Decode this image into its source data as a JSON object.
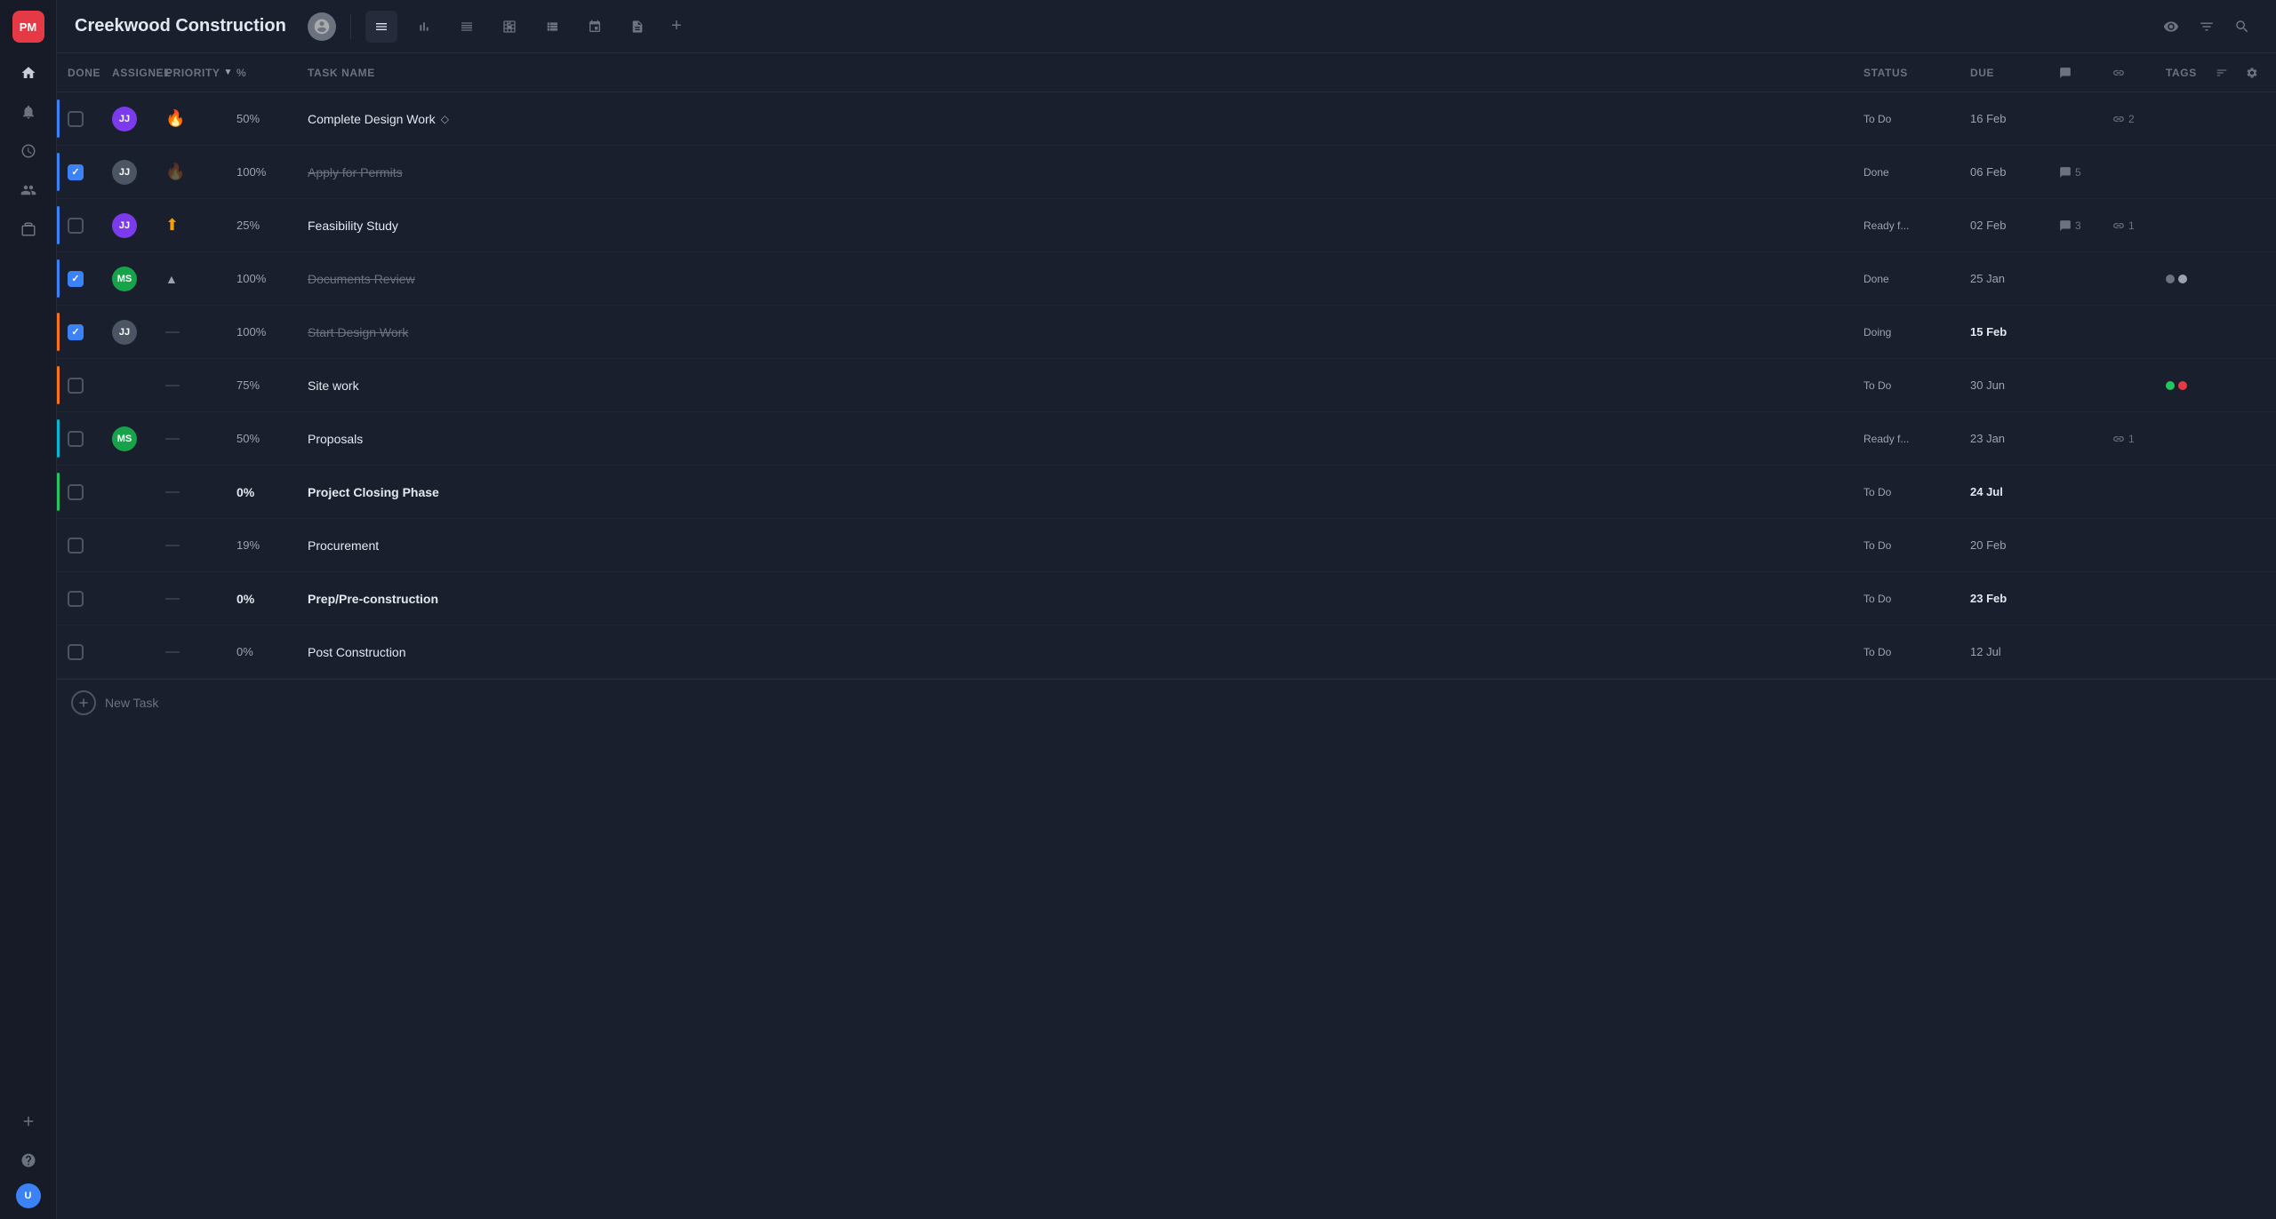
{
  "app": {
    "logo": "PM",
    "project_title": "Creekwood Construction"
  },
  "sidebar": {
    "icons": [
      {
        "name": "home-icon",
        "glyph": "⌂",
        "active": false
      },
      {
        "name": "notifications-icon",
        "glyph": "🔔",
        "active": false
      },
      {
        "name": "clock-icon",
        "glyph": "⏱",
        "active": false
      },
      {
        "name": "users-icon",
        "glyph": "👥",
        "active": false
      },
      {
        "name": "briefcase-icon",
        "glyph": "💼",
        "active": false
      }
    ],
    "bottom_icons": [
      {
        "name": "add-icon",
        "glyph": "+",
        "active": false
      },
      {
        "name": "help-icon",
        "glyph": "?",
        "active": false
      }
    ]
  },
  "topbar": {
    "view_icons": [
      {
        "name": "list-view-icon",
        "glyph": "☰",
        "active": true
      },
      {
        "name": "chart-view-icon",
        "glyph": "⦿",
        "active": false
      },
      {
        "name": "menu-view-icon",
        "glyph": "≡",
        "active": false
      },
      {
        "name": "table-view-icon",
        "glyph": "⊞",
        "active": false
      },
      {
        "name": "pulse-view-icon",
        "glyph": "∿",
        "active": false
      },
      {
        "name": "calendar-view-icon",
        "glyph": "📅",
        "active": false
      },
      {
        "name": "doc-view-icon",
        "glyph": "📄",
        "active": false
      }
    ],
    "right_icons": [
      {
        "name": "eye-icon",
        "glyph": "👁"
      },
      {
        "name": "filter-icon",
        "glyph": "⚗"
      },
      {
        "name": "search-icon",
        "glyph": "🔍"
      }
    ]
  },
  "table": {
    "columns": [
      {
        "id": "done",
        "label": "DONE"
      },
      {
        "id": "assignee",
        "label": "ASSIGNEE"
      },
      {
        "id": "priority",
        "label": "PRIORITY"
      },
      {
        "id": "percent",
        "label": "%"
      },
      {
        "id": "task_name",
        "label": "TASK NAME"
      },
      {
        "id": "status",
        "label": "STATUS"
      },
      {
        "id": "due",
        "label": "DUE"
      },
      {
        "id": "comments",
        "label": ""
      },
      {
        "id": "links",
        "label": ""
      },
      {
        "id": "tags",
        "label": "TAGS"
      }
    ],
    "rows": [
      {
        "id": "row1",
        "done": false,
        "assignee_initials": "JJ",
        "assignee_color": "av-purple",
        "priority_type": "fire",
        "priority_glyph": "🔥",
        "percent": "50%",
        "percent_style": "normal",
        "task_name": "Complete Design Work",
        "task_style": "normal",
        "has_diamond": true,
        "status": "To Do",
        "status_style": "normal",
        "due": "16 Feb",
        "due_style": "normal",
        "comments": 0,
        "links": 2,
        "tags": [],
        "bar_color": "bar-blue"
      },
      {
        "id": "row2",
        "done": true,
        "assignee_initials": "JJ",
        "assignee_color": "av-gray",
        "priority_type": "fire-gray",
        "priority_glyph": "🔥",
        "percent": "100%",
        "percent_style": "normal",
        "task_name": "Apply for Permits",
        "task_style": "strikethrough",
        "has_diamond": false,
        "status": "Done",
        "status_style": "normal",
        "due": "06 Feb",
        "due_style": "normal",
        "comments": 5,
        "links": 0,
        "tags": [],
        "bar_color": "bar-blue"
      },
      {
        "id": "row3",
        "done": false,
        "assignee_initials": "JJ",
        "assignee_color": "av-purple",
        "priority_type": "arrow-up",
        "priority_glyph": "⬆",
        "percent": "25%",
        "percent_style": "normal",
        "task_name": "Feasibility Study",
        "task_style": "normal",
        "has_diamond": false,
        "status": "Ready f...",
        "status_style": "normal",
        "due": "02 Feb",
        "due_style": "normal",
        "comments": 3,
        "links": 1,
        "tags": [],
        "bar_color": "bar-blue"
      },
      {
        "id": "row4",
        "done": true,
        "assignee_initials": "MS",
        "assignee_color": "av-green",
        "priority_type": "triangle",
        "priority_glyph": "▲",
        "percent": "100%",
        "percent_style": "normal",
        "task_name": "Documents Review",
        "task_style": "strikethrough",
        "has_diamond": false,
        "status": "Done",
        "status_style": "normal",
        "due": "25 Jan",
        "due_style": "normal",
        "comments": 0,
        "links": 0,
        "tags": [
          {
            "color": "#6b7280"
          },
          {
            "color": "#9ca3af"
          }
        ],
        "bar_color": "bar-blue"
      },
      {
        "id": "row5",
        "done": true,
        "assignee_initials": "JJ",
        "assignee_color": "av-gray",
        "priority_type": "dash",
        "priority_glyph": "—",
        "percent": "100%",
        "percent_style": "normal",
        "task_name": "Start Design Work",
        "task_style": "strikethrough",
        "has_diamond": false,
        "status": "Doing",
        "status_style": "normal",
        "due": "15 Feb",
        "due_style": "bold",
        "comments": 0,
        "links": 0,
        "tags": [],
        "bar_color": "bar-orange"
      },
      {
        "id": "row6",
        "done": false,
        "assignee_initials": "",
        "assignee_color": "",
        "priority_type": "dash",
        "priority_glyph": "—",
        "percent": "75%",
        "percent_style": "normal",
        "task_name": "Site work",
        "task_style": "normal",
        "has_diamond": false,
        "status": "To Do",
        "status_style": "normal",
        "due": "30 Jun",
        "due_style": "normal",
        "comments": 0,
        "links": 0,
        "tags": [
          {
            "color": "#22c55e"
          },
          {
            "color": "#e63946"
          }
        ],
        "bar_color": "bar-orange"
      },
      {
        "id": "row7",
        "done": false,
        "assignee_initials": "MS",
        "assignee_color": "av-green",
        "priority_type": "dash",
        "priority_glyph": "—",
        "percent": "50%",
        "percent_style": "normal",
        "task_name": "Proposals",
        "task_style": "normal",
        "has_diamond": false,
        "status": "Ready f...",
        "status_style": "normal",
        "due": "23 Jan",
        "due_style": "normal",
        "comments": 0,
        "links": 1,
        "tags": [],
        "bar_color": "bar-cyan"
      },
      {
        "id": "row8",
        "done": false,
        "assignee_initials": "",
        "assignee_color": "",
        "priority_type": "dash",
        "priority_glyph": "—",
        "percent": "0%",
        "percent_style": "bold",
        "task_name": "Project Closing Phase",
        "task_style": "bold",
        "has_diamond": false,
        "status": "To Do",
        "status_style": "normal",
        "due": "24 Jul",
        "due_style": "bold",
        "comments": 0,
        "links": 0,
        "tags": [],
        "bar_color": "bar-green"
      },
      {
        "id": "row9",
        "done": false,
        "assignee_initials": "",
        "assignee_color": "",
        "priority_type": "dash",
        "priority_glyph": "—",
        "percent": "19%",
        "percent_style": "normal",
        "task_name": "Procurement",
        "task_style": "normal",
        "has_diamond": false,
        "status": "To Do",
        "status_style": "normal",
        "due": "20 Feb",
        "due_style": "normal",
        "comments": 0,
        "links": 0,
        "tags": [],
        "bar_color": "bar-none"
      },
      {
        "id": "row10",
        "done": false,
        "assignee_initials": "",
        "assignee_color": "",
        "priority_type": "dash",
        "priority_glyph": "—",
        "percent": "0%",
        "percent_style": "bold",
        "task_name": "Prep/Pre-construction",
        "task_style": "bold",
        "has_diamond": false,
        "status": "To Do",
        "status_style": "normal",
        "due": "23 Feb",
        "due_style": "bold",
        "comments": 0,
        "links": 0,
        "tags": [],
        "bar_color": "bar-none"
      },
      {
        "id": "row11",
        "done": false,
        "assignee_initials": "",
        "assignee_color": "",
        "priority_type": "dash",
        "priority_glyph": "—",
        "percent": "0%",
        "percent_style": "normal",
        "task_name": "Post Construction",
        "task_style": "normal",
        "has_diamond": false,
        "status": "To Do",
        "status_style": "normal",
        "due": "12 Jul",
        "due_style": "normal",
        "comments": 0,
        "links": 0,
        "tags": [],
        "bar_color": "bar-none"
      }
    ],
    "new_task_label": "New Task"
  }
}
